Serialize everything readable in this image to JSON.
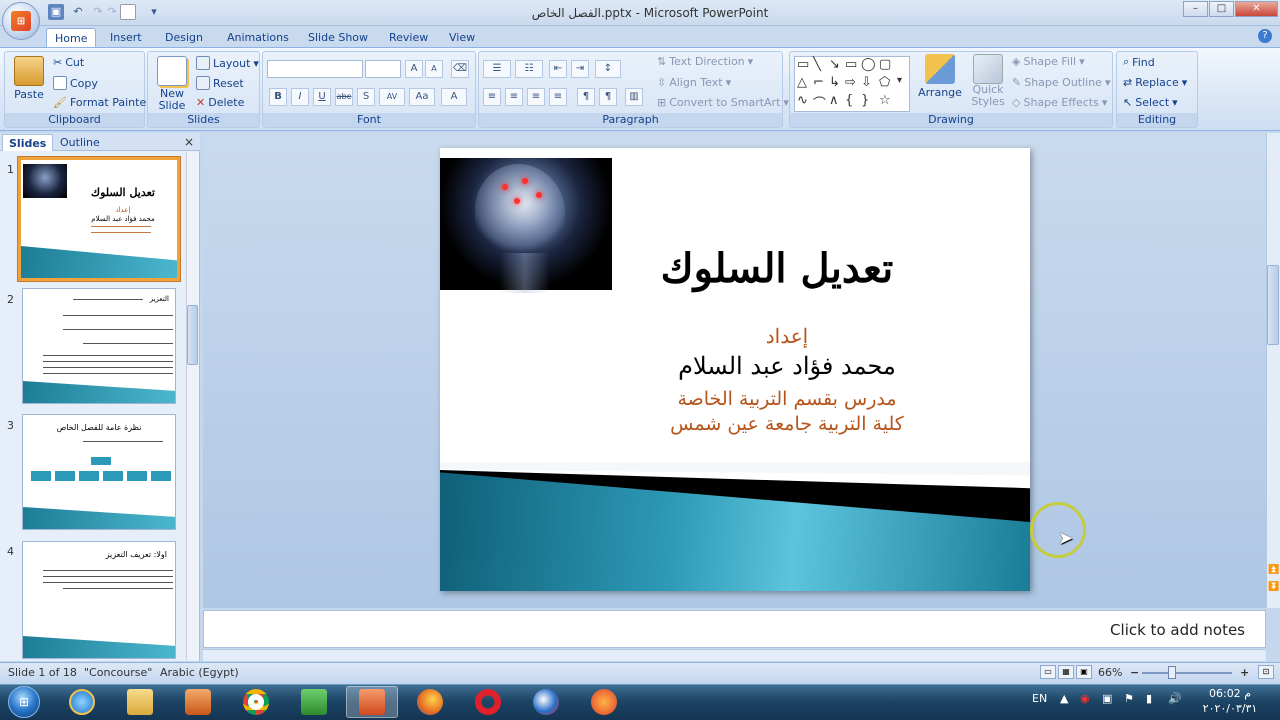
{
  "window": {
    "title": "الفصل الخاص.pptx - Microsoft PowerPoint",
    "min": "–",
    "max": "□",
    "close": "✕"
  },
  "qat": {
    "save_icon": "save-icon",
    "undo": "↶",
    "redo": "↷",
    "newdoc": "new-doc-icon",
    "dropdown": "▾"
  },
  "tabs": [
    {
      "label": "Home"
    },
    {
      "label": "Insert"
    },
    {
      "label": "Design"
    },
    {
      "label": "Animations"
    },
    {
      "label": "Slide Show"
    },
    {
      "label": "Review"
    },
    {
      "label": "View"
    }
  ],
  "ribbon": {
    "clipboard": {
      "label": "Clipboard",
      "paste": "Paste",
      "cut": "Cut",
      "copy": "Copy",
      "format_painter": "Format Painter"
    },
    "slides": {
      "label": "Slides",
      "new_slide": "New Slide",
      "layout": "Layout",
      "reset": "Reset",
      "delete": "Delete"
    },
    "font": {
      "label": "Font",
      "bold": "B",
      "italic": "I",
      "underline": "U",
      "strike": "abe",
      "shadow": "S",
      "spacing": "AV",
      "case": "Aa",
      "color": "A",
      "grow": "A",
      "shrink": "A"
    },
    "paragraph": {
      "label": "Paragraph",
      "text_direction": "Text Direction",
      "align_text": "Align Text",
      "convert_smartart": "Convert to SmartArt"
    },
    "drawing": {
      "label": "Drawing",
      "arrange": "Arrange",
      "quick_styles": "Quick Styles",
      "shape_fill": "Shape Fill",
      "shape_outline": "Shape Outline",
      "shape_effects": "Shape Effects"
    },
    "editing": {
      "label": "Editing",
      "find": "Find",
      "replace": "Replace",
      "select": "Select"
    }
  },
  "panel": {
    "tab_slides": "Slides",
    "tab_outline": "Outline",
    "close": "×"
  },
  "thumbnails": [
    {
      "num": "1",
      "title": "تعديل السلوك",
      "line1": "إعداد",
      "line2": "محمد فؤاد عبد السلام"
    },
    {
      "num": "2",
      "text": "التعزيز"
    },
    {
      "num": "3",
      "title": "نظرة عامة للفصل الخاص"
    },
    {
      "num": "4",
      "title": "اولا: تعريف التعزيز"
    }
  ],
  "slide": {
    "title": "تعديل السلوك",
    "prepared": "إعداد",
    "author": "محمد فؤاد عبد السلام",
    "position": "مدرس بقسم التربية الخاصة",
    "college": "كلية التربية جامعة عين شمس"
  },
  "notes": {
    "placeholder": "Click to add notes"
  },
  "statusbar": {
    "slide_info": "Slide 1 of 18",
    "theme": "\"Concourse\"",
    "language": "Arabic (Egypt)",
    "zoom": "66%",
    "zoom_out": "−",
    "zoom_in": "+"
  },
  "taskbar": {
    "lang": "EN",
    "time": "06:02 م",
    "date": "٢٠٢٠/٠٣/٣١"
  },
  "colors": {
    "accent": "#2b9ab8",
    "title_orange": "#b5541b",
    "ribbon_text": "#15428b"
  }
}
